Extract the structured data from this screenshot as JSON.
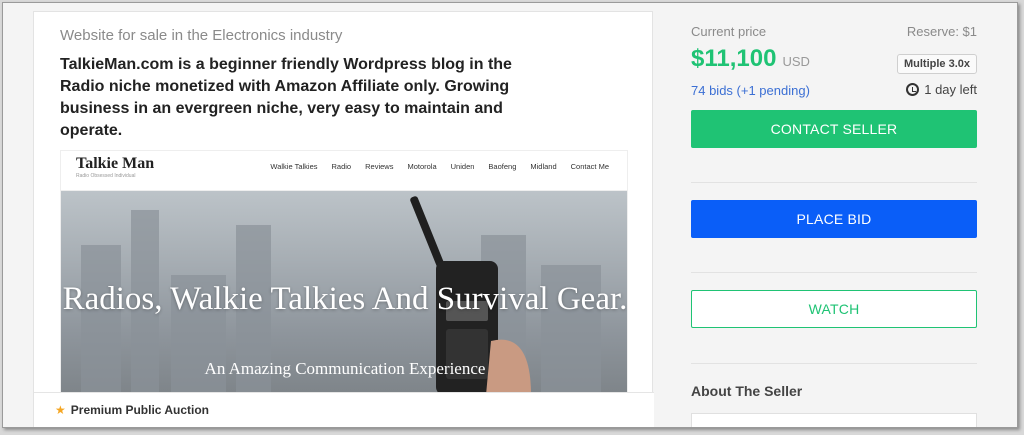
{
  "listing": {
    "industry": "Website for sale in the Electronics industry",
    "headline": "TalkieMan.com is a beginner friendly Wordpress blog in the Radio niche monetized with Amazon Affiliate only. Growing business in an evergreen niche, very easy to maintain and operate.",
    "badge": "Premium Public Auction"
  },
  "preview": {
    "logo": "Talkie Man",
    "tagline": "Radio Obsessed Individual",
    "menu": [
      "Walkie Talkies",
      "Radio",
      "Reviews",
      "Motorola",
      "Uniden",
      "Baofeng",
      "Midland",
      "Contact Me"
    ],
    "hero_title": "Radios, Walkie Talkies And Survival Gear.",
    "hero_sub": "An Amazing Communication Experience"
  },
  "sidebar": {
    "price_label": "Current price",
    "reserve": "Reserve: $1",
    "price": "$11,100",
    "currency": "USD",
    "multiple": "Multiple 3.0x",
    "bids": "74 bids (+1 pending)",
    "time_left": "1 day left",
    "contact_label": "CONTACT SELLER",
    "bid_label": "PLACE BID",
    "watch_label": "WATCH",
    "about_label": "About The Seller"
  },
  "colors": {
    "green": "#1fc374",
    "blue": "#0a5ef8",
    "link": "#3b6fd4"
  },
  "icons": {
    "star": "star-icon",
    "clock": "clock-icon"
  }
}
